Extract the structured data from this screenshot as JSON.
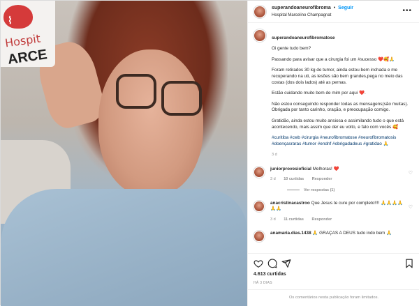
{
  "post": {
    "username": "superandoaneurofibroma",
    "separator": "•",
    "follow_label": "Seguir",
    "location": "Hospital Marcelino Champagnat",
    "more_label": "•••"
  },
  "caption": {
    "username": "superandoaneurofibromatose",
    "paragraphs": [
      "Oi gente tudo bem?",
      "Passando para avisar que a cirurgia foi um #sucesso ❤️🥰🙏",
      "Foram retirados 30 kg de tumor, ainda estou bem inchada e me recuperando na uti, as lesões são bem grandes,pega no meio das costas (dos dois lados) até as pernas.",
      "Estão cuidando muito bem de mim por aqui ❤️.",
      "Não estou conseguindo responder todas as mensagens(são muitas).\nObrigada por tanto carinho, oração, e preocupação comigo.",
      "Gratidão, ainda estou muito ansiosa e assimilando tudo o que está acontecendo, mais assim que der eu volto, e falo com vocês 🥰"
    ],
    "hashtags": "#curitiba #cwb #cirurgia #neurofibromatose #neurofibromatosis #doençasraras #tumor #endnf #obrigadadeus #gratidao 🙏",
    "time": "3 d"
  },
  "comments": [
    {
      "username": "juniorprovesioficial",
      "text": " Melhoras! ❤️",
      "time": "3 d",
      "likes": "10 curtidas",
      "reply": "Responder",
      "replies": "Ver respostas (1)"
    },
    {
      "username": "anacristinacastroo",
      "text": " Que Jesus te cure por completo!!!! 🙏🙏🙏🙏🙏🙏",
      "time": "3 d",
      "likes": "11 curtidas",
      "reply": "Responder"
    },
    {
      "username": "anamaria.dias.1438",
      "text": " 🙏 GRAÇAS A DEUS tudo indo bem 🙏"
    }
  ],
  "footer": {
    "likes": "4.613 curtidas",
    "date": "HÁ 3 DIAS",
    "limited": "Os comentários nesta publicação foram limitados."
  },
  "photo_sign": {
    "text_script": "Hospit",
    "text_bold": "ARCE"
  }
}
